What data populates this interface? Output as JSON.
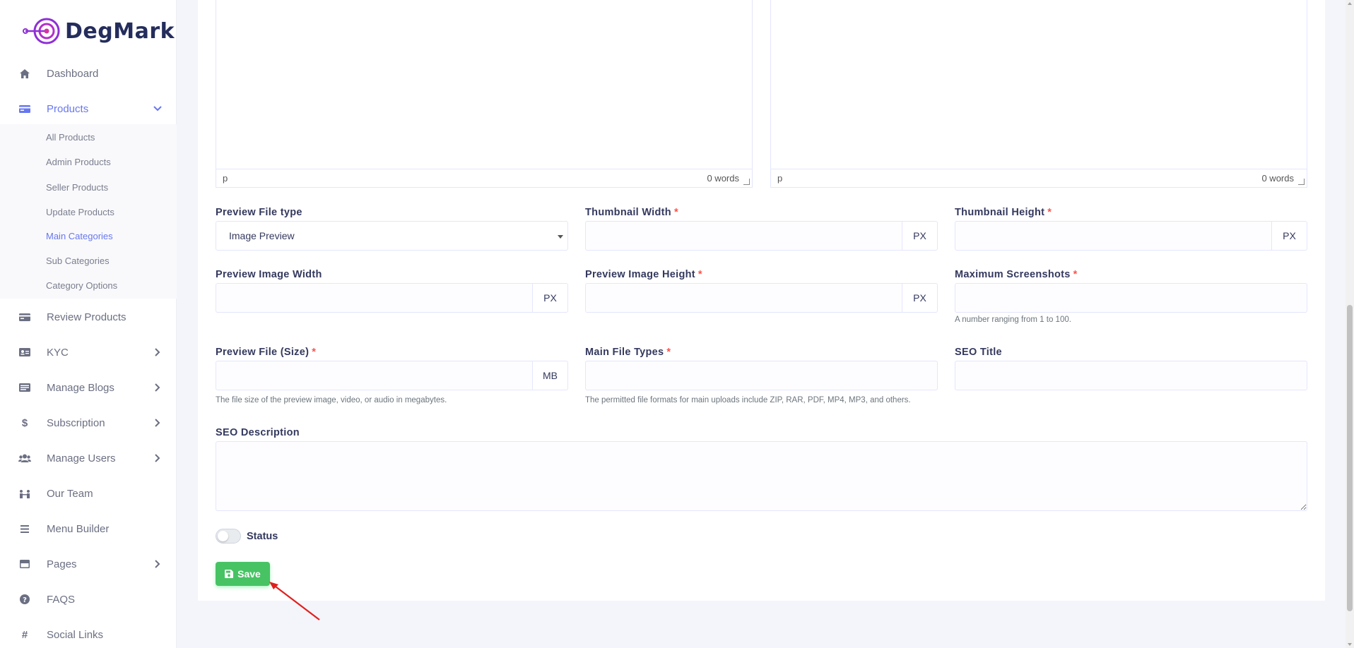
{
  "brand": {
    "name": "DegMark"
  },
  "sidebar": {
    "items": [
      {
        "label": "Dashboard",
        "icon": "home-icon"
      },
      {
        "label": "Products",
        "icon": "card-icon",
        "active": true,
        "expanded": true
      },
      {
        "label": "Review Products",
        "icon": "card-icon"
      },
      {
        "label": "KYC",
        "icon": "id-card-icon"
      },
      {
        "label": "Manage Blogs",
        "icon": "blog-icon"
      },
      {
        "label": "Subscription",
        "icon": "dollar-icon"
      },
      {
        "label": "Manage Users",
        "icon": "users-icon"
      },
      {
        "label": "Our Team",
        "icon": "team-icon"
      },
      {
        "label": "Menu Builder",
        "icon": "bars-icon"
      },
      {
        "label": "Pages",
        "icon": "page-icon"
      },
      {
        "label": "FAQS",
        "icon": "question-icon"
      },
      {
        "label": "Social Links",
        "icon": "hash-icon"
      }
    ],
    "submenu": [
      {
        "label": "All Products"
      },
      {
        "label": "Admin Products"
      },
      {
        "label": "Seller Products"
      },
      {
        "label": "Update Products"
      },
      {
        "label": "Main Categories",
        "active": true
      },
      {
        "label": "Sub Categories"
      },
      {
        "label": "Category Options"
      }
    ]
  },
  "editors": [
    {
      "path": "p",
      "word_count": "0 words"
    },
    {
      "path": "p",
      "word_count": "0 words"
    }
  ],
  "form": {
    "preview_file_type": {
      "label": "Preview File type",
      "value": "Image Preview"
    },
    "thumbnail_width": {
      "label": "Thumbnail Width",
      "required": "*",
      "unit": "PX",
      "value": ""
    },
    "thumbnail_height": {
      "label": "Thumbnail Height",
      "required": "*",
      "unit": "PX",
      "value": ""
    },
    "preview_image_width": {
      "label": "Preview Image Width",
      "unit": "PX",
      "value": ""
    },
    "preview_image_height": {
      "label": "Preview Image Height",
      "required": "*",
      "unit": "PX",
      "value": ""
    },
    "maximum_screenshots": {
      "label": "Maximum Screenshots",
      "required": "*",
      "help": "A number ranging from 1 to 100.",
      "value": ""
    },
    "preview_file_size": {
      "label": "Preview File (Size)",
      "required": "*",
      "unit": "MB",
      "help": "The file size of the preview image, video, or audio in megabytes.",
      "value": ""
    },
    "main_file_types": {
      "label": "Main File Types",
      "required": "*",
      "help": "The permitted file formats for main uploads include ZIP, RAR, PDF, MP4, MP3, and others.",
      "value": ""
    },
    "seo_title": {
      "label": "SEO Title",
      "value": ""
    },
    "seo_description": {
      "label": "SEO Description",
      "value": ""
    },
    "status": {
      "label": "Status",
      "on": false
    },
    "save_label": "Save"
  },
  "colors": {
    "accent": "#6777ef",
    "success": "#47c363",
    "required": "#fc544b",
    "annotation": "#e0201e"
  }
}
